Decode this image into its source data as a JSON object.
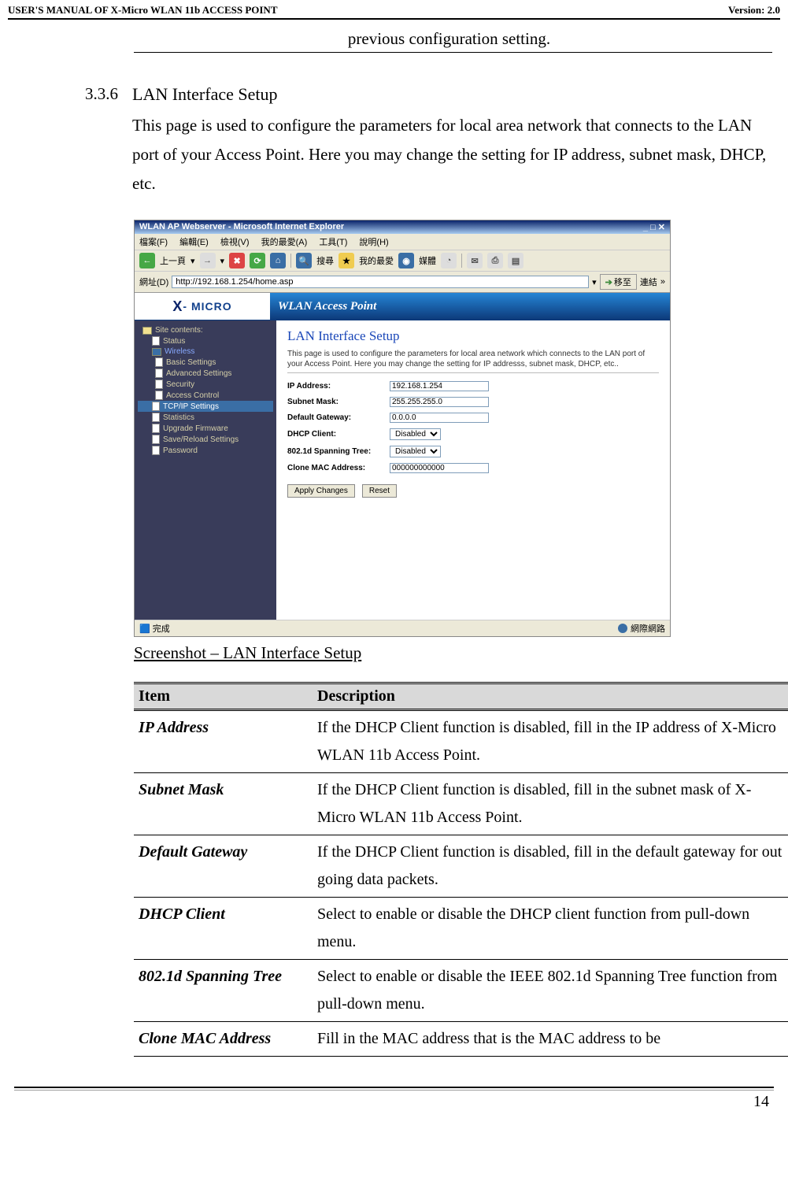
{
  "header": {
    "left": "USER'S MANUAL OF X-Micro WLAN 11b ACCESS POINT",
    "right": "Version: 2.0"
  },
  "prev_config": "previous configuration setting.",
  "section": {
    "number": "3.3.6",
    "title": "LAN Interface Setup",
    "text": "This page is used to configure the parameters for local area network that connects to the LAN port of your Access Point. Here you may change the setting for IP address, subnet mask, DHCP, etc."
  },
  "screenshot": {
    "window_title": "WLAN AP Webserver - Microsoft Internet Explorer",
    "menus": [
      "檔案(F)",
      "編輯(E)",
      "檢視(V)",
      "我的最愛(A)",
      "工具(T)",
      "說明(H)"
    ],
    "toolbar": {
      "back": "上一頁",
      "search": "搜尋",
      "favorites": "我的最愛",
      "media": "媒體"
    },
    "address_label": "網址(D)",
    "address_url": "http://192.168.1.254/home.asp",
    "go": "移至",
    "links": "連結",
    "logo": "X- MICRO",
    "banner": "WLAN Access Point",
    "sidebar": {
      "root": "Site contents:",
      "items": [
        "Status",
        "Wireless"
      ],
      "wireless_sub": [
        "Basic Settings",
        "Advanced Settings",
        "Security",
        "Access Control"
      ],
      "rest": [
        "TCP/IP Settings",
        "Statistics",
        "Upgrade Firmware",
        "Save/Reload Settings",
        "Password"
      ]
    },
    "main": {
      "heading": "LAN Interface Setup",
      "desc": "This page is used to configure the parameters for local area network which connects to the LAN port of your Access Point. Here you may change the setting for IP addresss, subnet mask, DHCP, etc..",
      "fields": {
        "ip_label": "IP Address:",
        "ip_value": "192.168.1.254",
        "subnet_label": "Subnet Mask:",
        "subnet_value": "255.255.255.0",
        "gateway_label": "Default Gateway:",
        "gateway_value": "0.0.0.0",
        "dhcp_label": "DHCP Client:",
        "dhcp_value": "Disabled",
        "spanning_label": "802.1d Spanning Tree:",
        "spanning_value": "Disabled",
        "mac_label": "Clone MAC Address:",
        "mac_value": "000000000000"
      },
      "apply_btn": "Apply Changes",
      "reset_btn": "Reset"
    },
    "status_left": "完成",
    "status_right": "網際網路"
  },
  "caption": "Screenshot – LAN Interface Setup",
  "table": {
    "headers": [
      "Item",
      "Description"
    ],
    "rows": [
      {
        "item": "IP Address",
        "desc": "If the DHCP Client function is disabled, fill in the IP address of X-Micro WLAN 11b Access Point."
      },
      {
        "item": "Subnet Mask",
        "desc": "If the DHCP Client function is disabled, fill in the subnet mask of X-Micro WLAN 11b Access Point."
      },
      {
        "item": "Default Gateway",
        "desc": "If the DHCP Client function is disabled, fill in the default gateway for out going data packets."
      },
      {
        "item": "DHCP Client",
        "desc": "Select to enable or disable the DHCP client function from pull-down menu."
      },
      {
        "item": "802.1d Spanning Tree",
        "desc": "Select to enable or disable the IEEE 802.1d Spanning Tree function from pull-down menu."
      },
      {
        "item": "Clone MAC Address",
        "desc": "Fill in the MAC address that is the MAC address to be"
      }
    ]
  },
  "page_number": "14"
}
